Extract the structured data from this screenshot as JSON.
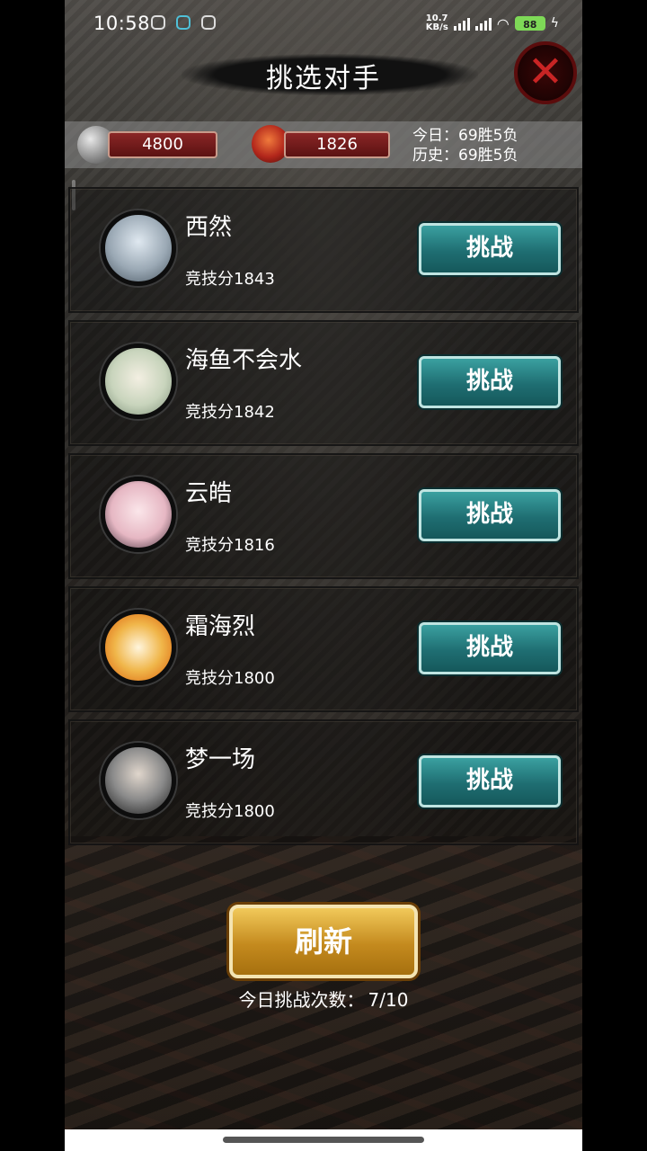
{
  "status": {
    "time": "10:58",
    "net_speed": "10.7\nKB/s",
    "battery": "88"
  },
  "header": {
    "title": "挑选对手"
  },
  "resources": {
    "coins": "4800",
    "dragon": "1826",
    "today_label": "今日：69胜5负",
    "history_label": "历史：69胜5负"
  },
  "opponents": [
    {
      "name": "西然",
      "score": "竞技分1843",
      "button": "挑战"
    },
    {
      "name": "海鱼不会水",
      "score": "竞技分1842",
      "button": "挑战"
    },
    {
      "name": "云皓",
      "score": "竞技分1816",
      "button": "挑战"
    },
    {
      "name": "霜海烈",
      "score": "竞技分1800",
      "button": "挑战"
    },
    {
      "name": "梦一场",
      "score": "竞技分1800",
      "button": "挑战"
    }
  ],
  "footer": {
    "refresh_label": "刷新",
    "challenge_count_label": "今日挑战次数：",
    "challenge_count_value": "7/10"
  },
  "colors": {
    "challenge_button": "#1f6e72",
    "refresh_button": "#c48a1e",
    "pill_red": "#8a2626",
    "close_red": "#c82424"
  },
  "icons": [
    "coin-icon",
    "dragon-icon",
    "close-icon"
  ]
}
